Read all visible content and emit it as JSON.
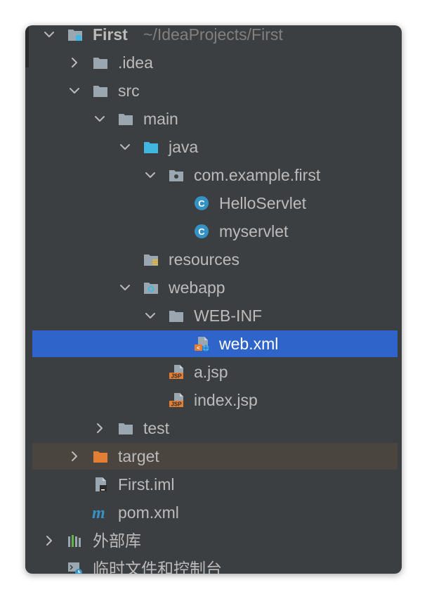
{
  "tree": {
    "root": {
      "name": "First",
      "path": "~/IdeaProjects/First"
    },
    "idea": ".idea",
    "src": "src",
    "main": "main",
    "java": "java",
    "package": "com.example.first",
    "hello_servlet": "HelloServlet",
    "myservlet": "myservlet",
    "resources": "resources",
    "webapp": "webapp",
    "web_inf": "WEB-INF",
    "web_xml": "web.xml",
    "a_jsp": "a.jsp",
    "index_jsp": "index.jsp",
    "test": "test",
    "target": "target",
    "first_iml": "First.iml",
    "pom_xml": "pom.xml",
    "external_libraries": "外部库",
    "scratches": "临时文件和控制台"
  },
  "colors": {
    "panel_bg": "#3c3f41",
    "selection": "#2f65ca",
    "excluded_row": "#4a453e",
    "folder_gray": "#9aa7b0",
    "source_folder_blue": "#40b6e0",
    "class_icon": "#3592c4",
    "target_folder": "#e57e35",
    "jsp_orange": "#e57e35"
  },
  "icons": {
    "root": "module-folder-icon",
    "folder": "folder-icon",
    "source_root": "source-folder-icon",
    "package": "package-icon",
    "class": "class-icon",
    "resources": "resources-folder-icon",
    "webapp": "web-folder-icon",
    "xml": "xml-descriptor-icon",
    "jsp": "jsp-file-icon",
    "excluded": "excluded-folder-icon",
    "iml": "iml-file-icon",
    "maven": "maven-icon",
    "libraries": "libraries-icon",
    "scratches": "scratches-icon"
  }
}
